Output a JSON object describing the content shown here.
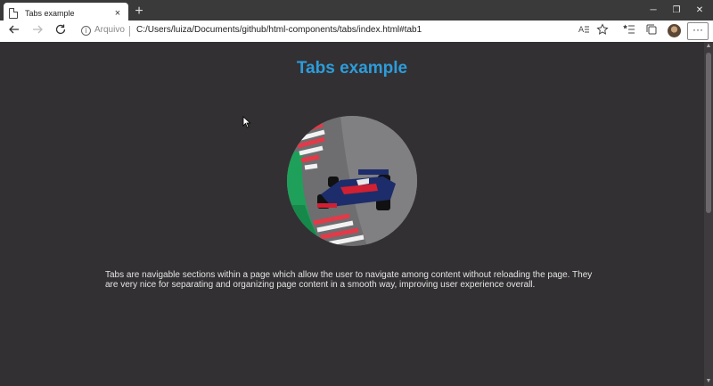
{
  "browser": {
    "tab_title": "Tabs example",
    "new_tab_symbol": "+",
    "close_symbol": "×",
    "site_label": "Arquivo",
    "url": "C:/Users/luiza/Documents/github/html-components/tabs/index.html#tab1",
    "window_controls": [
      "─",
      "❐",
      "✕"
    ],
    "more_symbol": "···"
  },
  "icons": {
    "back": "back-arrow-icon",
    "forward": "forward-arrow-icon",
    "refresh": "refresh-icon",
    "info": "info-icon",
    "read_aloud": "read-aloud-icon",
    "favorite": "star-icon",
    "favorites_list": "favorites-list-icon",
    "collections": "collections-icon"
  },
  "page": {
    "title": "Tabs example",
    "description": "Tabs are navigable sections within a page which allow the user to navigate among content without reloading the page. They are very nice for separating and organizing page content in a smooth way, improving user experience overall."
  },
  "colors": {
    "page_background": "#323032",
    "title": "#2d9cdb",
    "text": "#e4e4e4"
  }
}
